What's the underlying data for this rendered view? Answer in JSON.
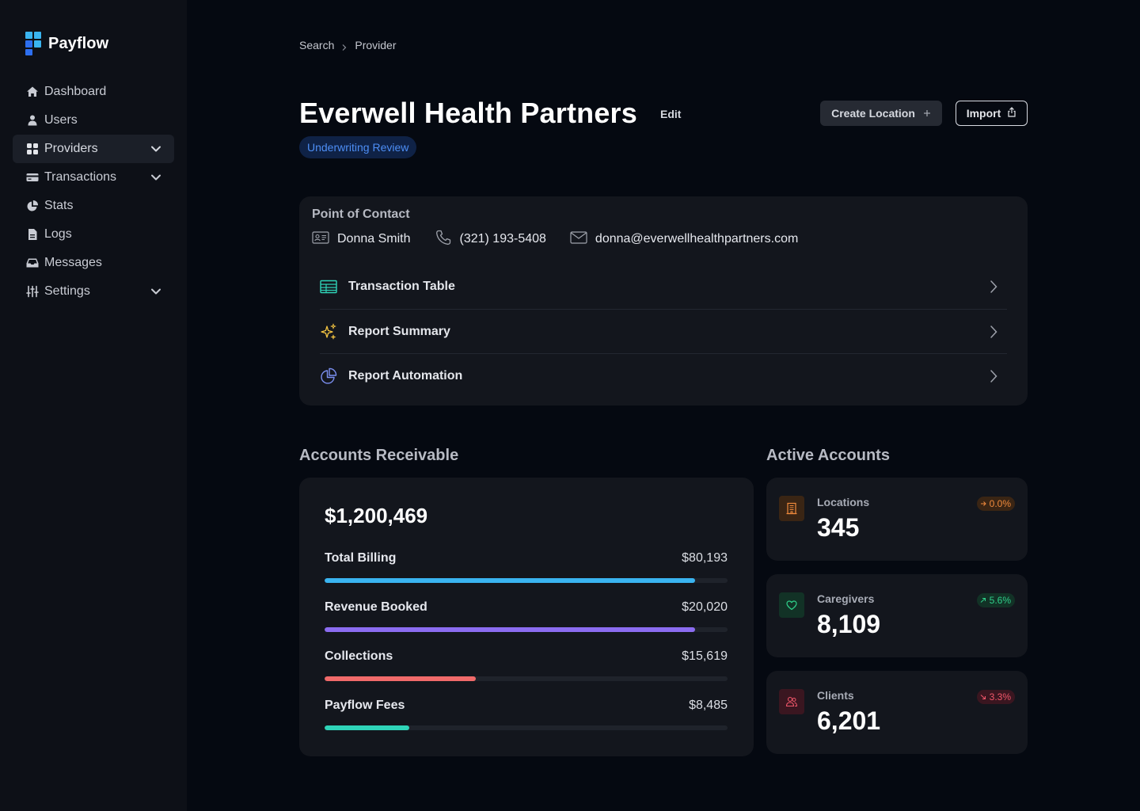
{
  "app": {
    "name": "Payflow"
  },
  "sidebar": {
    "items": [
      {
        "label": "Dashboard",
        "icon": "home-icon"
      },
      {
        "label": "Users",
        "icon": "user-icon"
      },
      {
        "label": "Providers",
        "icon": "grid-icon",
        "active": true,
        "expandable": true
      },
      {
        "label": "Transactions",
        "icon": "credit-card-icon",
        "expandable": true
      },
      {
        "label": "Stats",
        "icon": "pie-chart-icon"
      },
      {
        "label": "Logs",
        "icon": "document-icon"
      },
      {
        "label": "Messages",
        "icon": "inbox-icon"
      },
      {
        "label": "Settings",
        "icon": "sliders-icon",
        "expandable": true
      }
    ]
  },
  "breadcrumb": [
    "Search",
    "Provider"
  ],
  "header": {
    "title": "Everwell Health Partners",
    "edit_label": "Edit",
    "status": "Underwriting Review",
    "create_label": "Create Location",
    "import_label": "Import"
  },
  "contact": {
    "title": "Point of Contact",
    "name": "Donna Smith",
    "phone": "(321) 193-5408",
    "email": "donna@everwellhealthpartners.com"
  },
  "links": [
    {
      "label": "Transaction Table",
      "icon": "table-icon"
    },
    {
      "label": "Report Summary",
      "icon": "sparkles-icon"
    },
    {
      "label": "Report Automation",
      "icon": "pie-chart-icon"
    }
  ],
  "accounts_receivable": {
    "title": "Accounts Receivable",
    "total": "$1,200,469",
    "rows": [
      {
        "label": "Total Billing",
        "value": "$80,193",
        "progress": 0.92,
        "color": "#3ab4f0"
      },
      {
        "label": "Revenue Booked",
        "value": "$20,020",
        "progress": 0.92,
        "color": "#8b6cf0"
      },
      {
        "label": "Collections",
        "value": "$15,619",
        "progress": 0.376,
        "color": "#f06a6a"
      },
      {
        "label": "Payflow Fees",
        "value": "$8,485",
        "progress": 0.21,
        "color": "#2fd4b8"
      }
    ]
  },
  "active_accounts": {
    "title": "Active Accounts",
    "cards": [
      {
        "label": "Locations",
        "value": "345",
        "change": "0.0%",
        "trend": "flat",
        "icon": "building-icon",
        "color": "#f08a3c"
      },
      {
        "label": "Caregivers",
        "value": "8,109",
        "change": "5.6%",
        "trend": "up",
        "icon": "heart-icon",
        "color": "#2fcf8a"
      },
      {
        "label": "Clients",
        "value": "6,201",
        "change": "3.3%",
        "trend": "down",
        "icon": "users-icon",
        "color": "#f0566a"
      }
    ]
  },
  "colors": {
    "accent_blue": "#4d8ef5",
    "background": "#050911",
    "card": "#13161d"
  }
}
